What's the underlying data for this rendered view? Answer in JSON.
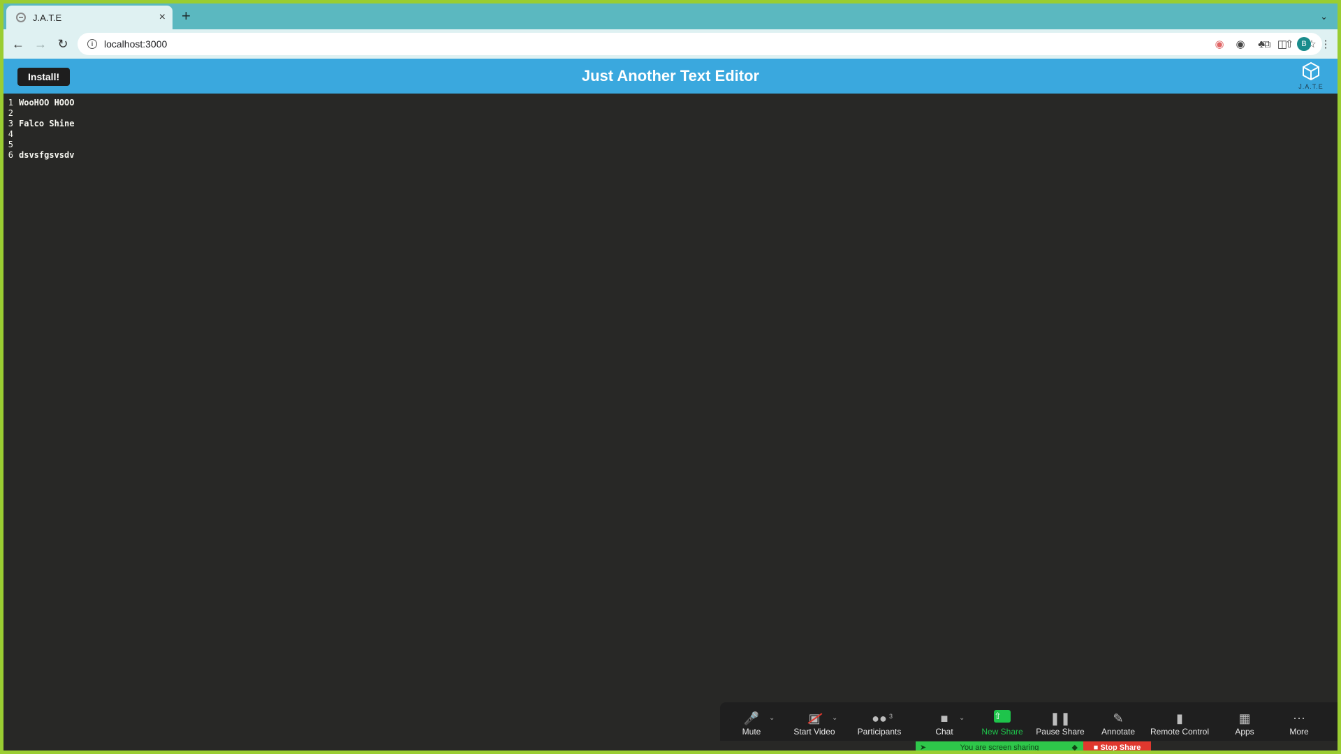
{
  "browser": {
    "tab_title": "J.A.T.E",
    "tab_close": "×",
    "new_tab": "+",
    "url": "localhost:3000",
    "profile_initial": "B"
  },
  "app": {
    "install_label": "Install!",
    "title": "Just Another Text Editor",
    "logo_text": "J.A.T.E"
  },
  "editor": {
    "lines": [
      {
        "n": "1",
        "text": "WooHOO HOOO"
      },
      {
        "n": "2",
        "text": ""
      },
      {
        "n": "3",
        "text": "Falco Shine"
      },
      {
        "n": "4",
        "text": ""
      },
      {
        "n": "5",
        "text": ""
      },
      {
        "n": "6",
        "text": "dsvsfgsvsdv"
      }
    ]
  },
  "zoom": {
    "mute": "Mute",
    "start_video": "Start Video",
    "participants": "Participants",
    "participants_count": "3",
    "chat": "Chat",
    "new_share": "New Share",
    "pause_share": "Pause Share",
    "annotate": "Annotate",
    "remote_control": "Remote Control",
    "apps": "Apps",
    "more": "More",
    "sharing_status": "You are screen sharing",
    "stop_share": "Stop Share"
  }
}
